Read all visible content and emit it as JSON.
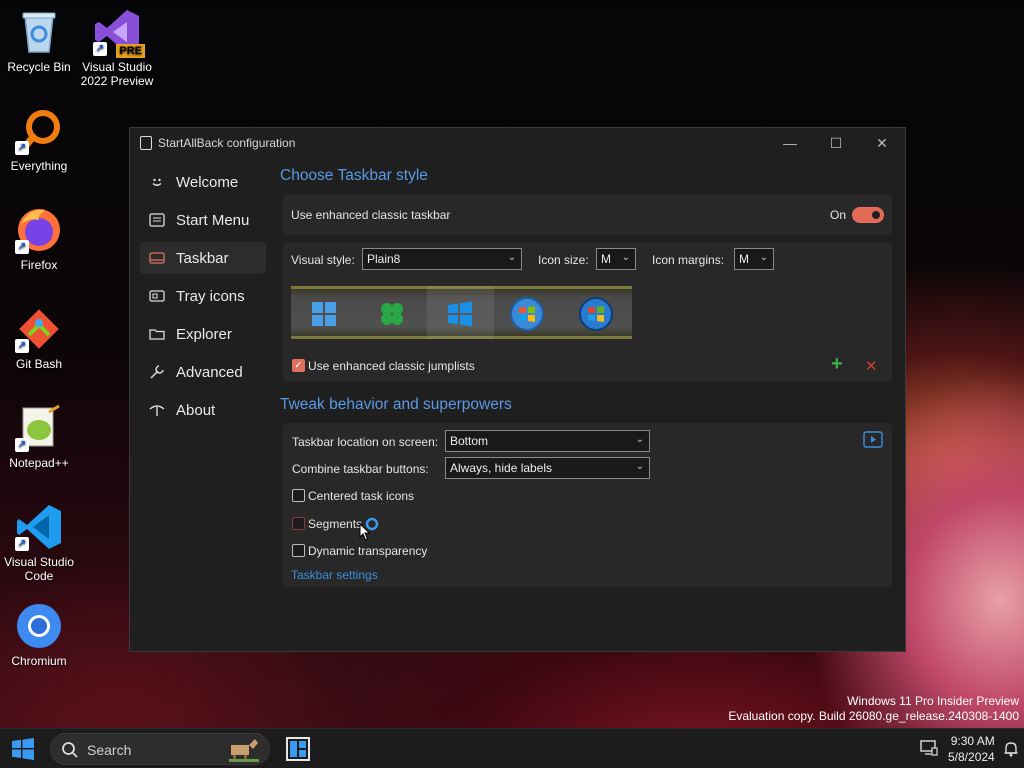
{
  "desktop": {
    "icons": [
      {
        "label": "Recycle Bin"
      },
      {
        "label": "Visual Studio 2022 Preview",
        "badge": "PRE"
      },
      {
        "label": "Everything"
      },
      {
        "label": "Firefox"
      },
      {
        "label": "Git Bash"
      },
      {
        "label": "Notepad++"
      },
      {
        "label": "Visual Studio Code"
      },
      {
        "label": "Chromium"
      }
    ],
    "watermark_line1": "Windows 11 Pro Insider Preview",
    "watermark_line2": "Evaluation copy. Build 26080.ge_release.240308-1400"
  },
  "window": {
    "title": "StartAllBack configuration",
    "controls": {
      "minimize": "—",
      "maximize": "☐",
      "close": "✕"
    }
  },
  "nav": {
    "items": [
      {
        "label": "Welcome",
        "icon": "smiley-icon"
      },
      {
        "label": "Start Menu",
        "icon": "start-menu-icon"
      },
      {
        "label": "Taskbar",
        "icon": "taskbar-icon",
        "active": true
      },
      {
        "label": "Tray icons",
        "icon": "tray-icon"
      },
      {
        "label": "Explorer",
        "icon": "folder-icon"
      },
      {
        "label": "Advanced",
        "icon": "wrench-icon"
      },
      {
        "label": "About",
        "icon": "about-icon"
      }
    ]
  },
  "taskbar_style": {
    "section_title": "Choose Taskbar style",
    "enhanced_label": "Use enhanced classic taskbar",
    "enhanced_state": "On",
    "visual_style_label": "Visual style:",
    "visual_style_value": "Plain8",
    "icon_size_label": "Icon size:",
    "icon_size_value": "M",
    "icon_margins_label": "Icon margins:",
    "icon_margins_value": "M",
    "jumplists_label": "Use enhanced classic jumplists",
    "jumplists_checked": true,
    "add_symbol": "+",
    "remove_symbol": "✕"
  },
  "behavior": {
    "section_title": "Tweak behavior and superpowers",
    "location_label": "Taskbar location on screen:",
    "location_value": "Bottom",
    "combine_label": "Combine taskbar buttons:",
    "combine_value": "Always, hide labels",
    "centered_label": "Centered task icons",
    "segments_label": "Segments",
    "dynamic_label": "Dynamic transparency",
    "settings_link": "Taskbar settings"
  },
  "taskbar": {
    "search_placeholder": "Search",
    "time": "9:30 AM",
    "date": "5/8/2024"
  },
  "colors": {
    "accent_blue": "#5a9ae6",
    "toggle_on": "#e06a55",
    "link": "#3a8ee0",
    "add_green": "#3cb043",
    "remove_red": "#d04040"
  }
}
